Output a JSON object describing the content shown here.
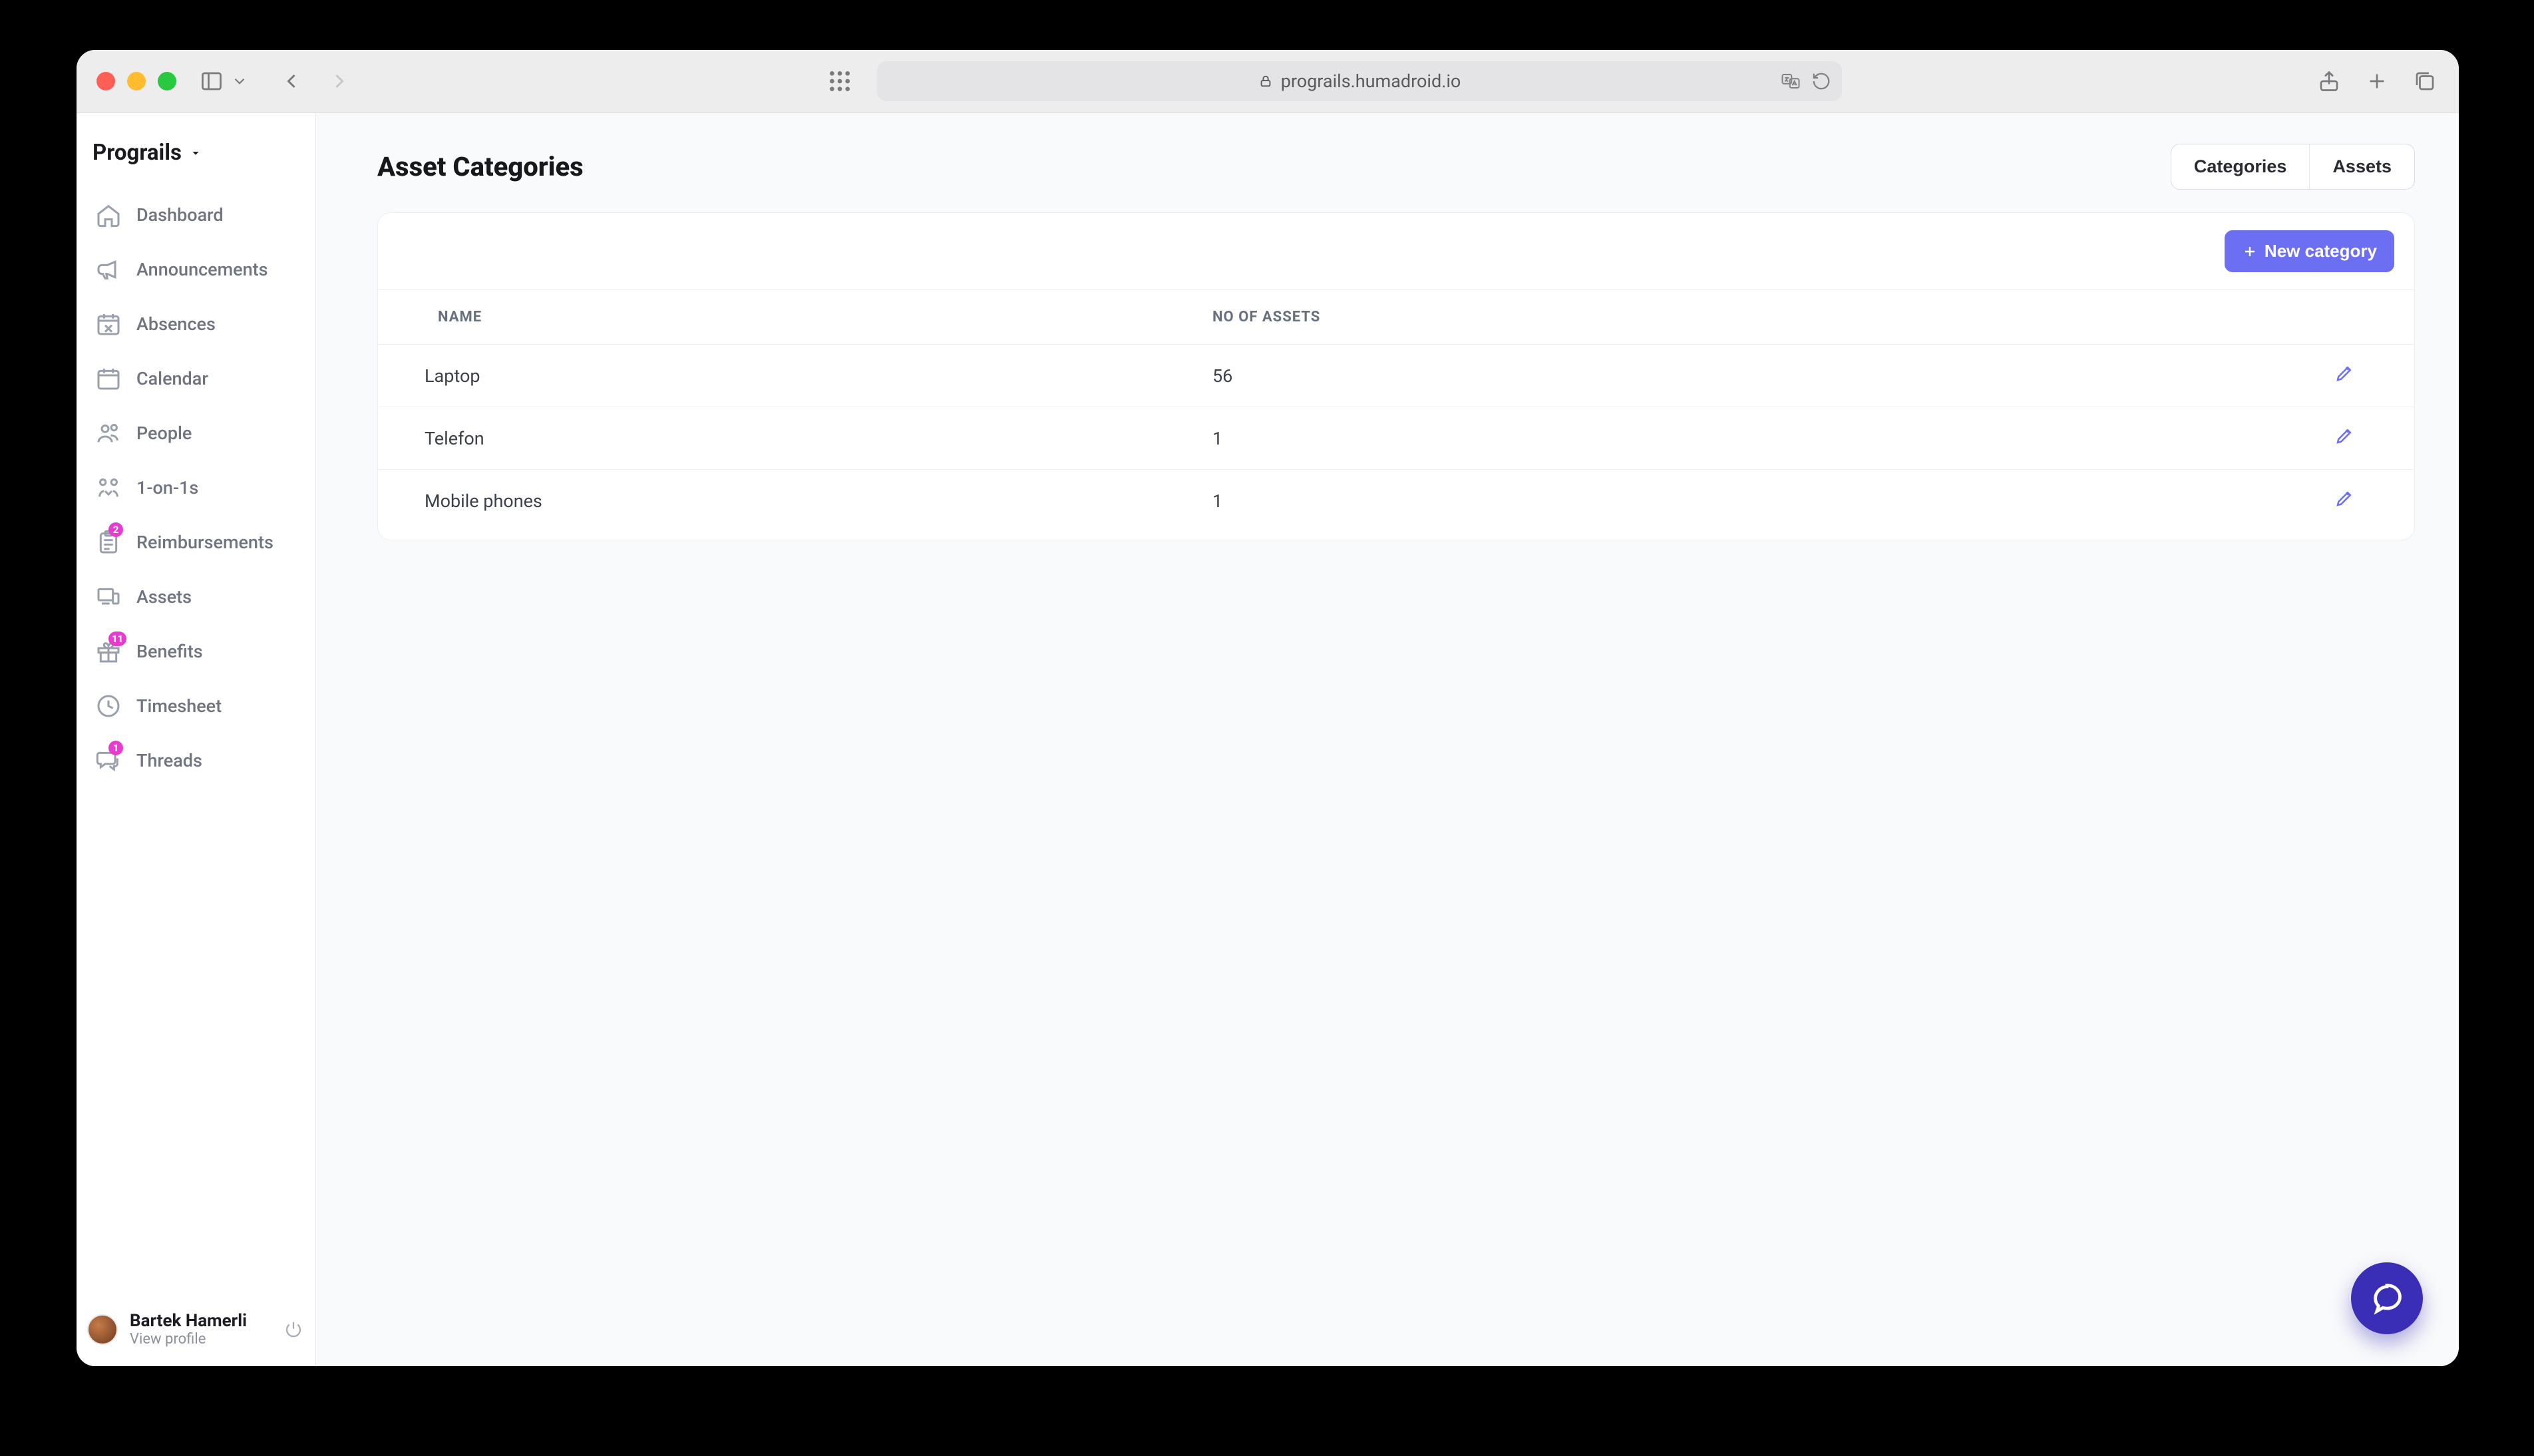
{
  "browser": {
    "url_display": "prograils.humadroid.io"
  },
  "org": {
    "name": "Prograils"
  },
  "sidebar": {
    "items": [
      {
        "label": "Dashboard"
      },
      {
        "label": "Announcements"
      },
      {
        "label": "Absences"
      },
      {
        "label": "Calendar"
      },
      {
        "label": "People"
      },
      {
        "label": "1-on-1s"
      },
      {
        "label": "Reimbursements",
        "badge": "2"
      },
      {
        "label": "Assets"
      },
      {
        "label": "Benefits",
        "badge": "11"
      },
      {
        "label": "Timesheet"
      },
      {
        "label": "Threads",
        "badge": "1"
      }
    ]
  },
  "profile": {
    "name": "Bartek Hamerli",
    "view": "View profile"
  },
  "main": {
    "title": "Asset Categories",
    "toggle": {
      "categories": "Categories",
      "assets": "Assets"
    },
    "new_button": "New category",
    "table": {
      "headers": {
        "name": "NAME",
        "count": "NO OF ASSETS"
      },
      "rows": [
        {
          "name": "Laptop",
          "count": "56"
        },
        {
          "name": "Telefon",
          "count": "1"
        },
        {
          "name": "Mobile phones",
          "count": "1"
        }
      ]
    }
  }
}
